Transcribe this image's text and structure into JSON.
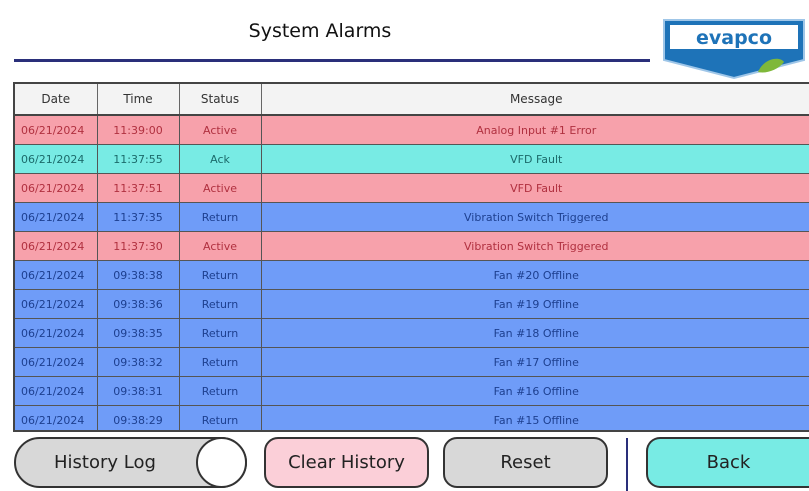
{
  "header": {
    "title": "System Alarms"
  },
  "logo": {
    "text": "evapco"
  },
  "table": {
    "columns": [
      "Date",
      "Time",
      "Status",
      "Message"
    ],
    "rows": [
      {
        "date": "06/21/2024",
        "time": "11:39:00",
        "status": "Active",
        "message": "Analog Input #1 Error",
        "state": "active"
      },
      {
        "date": "06/21/2024",
        "time": "11:37:55",
        "status": "Ack",
        "message": "VFD Fault",
        "state": "ack"
      },
      {
        "date": "06/21/2024",
        "time": "11:37:51",
        "status": "Active",
        "message": "VFD Fault",
        "state": "active"
      },
      {
        "date": "06/21/2024",
        "time": "11:37:35",
        "status": "Return",
        "message": "Vibration Switch Triggered",
        "state": "return"
      },
      {
        "date": "06/21/2024",
        "time": "11:37:30",
        "status": "Active",
        "message": "Vibration Switch Triggered",
        "state": "active"
      },
      {
        "date": "06/21/2024",
        "time": "09:38:38",
        "status": "Return",
        "message": "Fan #20 Offline",
        "state": "return"
      },
      {
        "date": "06/21/2024",
        "time": "09:38:36",
        "status": "Return",
        "message": "Fan #19 Offline",
        "state": "return"
      },
      {
        "date": "06/21/2024",
        "time": "09:38:35",
        "status": "Return",
        "message": "Fan #18 Offline",
        "state": "return"
      },
      {
        "date": "06/21/2024",
        "time": "09:38:32",
        "status": "Return",
        "message": "Fan #17 Offline",
        "state": "return"
      },
      {
        "date": "06/21/2024",
        "time": "09:38:31",
        "status": "Return",
        "message": "Fan #16 Offline",
        "state": "return"
      },
      {
        "date": "06/21/2024",
        "time": "09:38:29",
        "status": "Return",
        "message": "Fan #15 Offline",
        "state": "return"
      }
    ]
  },
  "buttons": {
    "history_log": "History Log",
    "clear_history": "Clear History",
    "reset": "Reset",
    "back": "Back"
  },
  "colors": {
    "active": "#f7a1ab",
    "ack": "#78ebe4",
    "return": "#6f9cf8",
    "title_rule": "#2a2f7a"
  }
}
